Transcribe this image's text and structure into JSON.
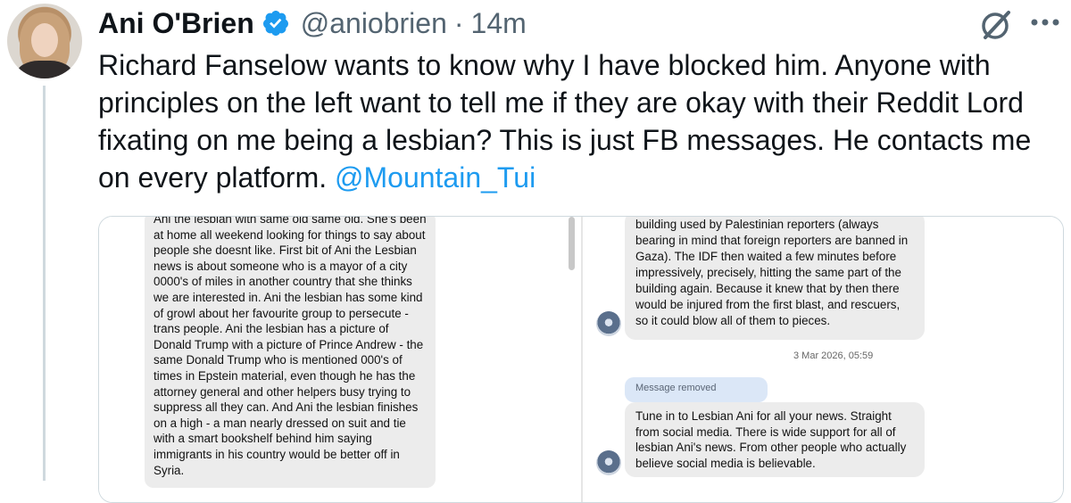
{
  "tweet": {
    "author_name": "Ani O'Brien",
    "handle": "@aniobrien",
    "separator": "·",
    "time": "14m",
    "text": "Richard Fanselow wants to know why I have blocked him. Anyone with principles on the left want to tell me if they are okay with their Reddit Lord fixating on me being a lesbian? This is just FB messages. He contacts me on every platform.",
    "mention": "@Mountain_Tui"
  },
  "icons": {
    "verified": "verified-badge-icon",
    "grok": "grok-icon",
    "more": "more-options-icon"
  },
  "colors": {
    "accent": "#1d9bf0",
    "text": "#0f1419",
    "muted": "#536471"
  },
  "media": {
    "left_message": "Ani the lesbian with same old same old. She's been at home all weekend looking for things to say about people she doesnt like. First bit of Ani the Lesbian news is about someone who is a mayor of a city 0000's of miles in another country that she thinks we are interested in. Ani the lesbian has some kind of growl about her favourite group to persecute - trans people. Ani the lesbian has a picture of Donald Trump with a picture of Prince Andrew  - the same Donald Trump who is mentioned 000's of times in Epstein material, even though he has the attorney general and other helpers busy trying to suppress all they can. And Ani the lesbian finishes on a high - a man nearly dressed on suit and tie with a smart bookshelf behind him saying immigrants in his country would be better off in Syria.",
    "right_message_1": "building used by Palestinian reporters (always bearing in mind that foreign reporters are banned in Gaza). The IDF then waited a few minutes before impressively, precisely, hitting the same part of the building again. Because it knew that by then there would be injured from the first blast, and rescuers, so it could blow all of them to pieces.",
    "timestamp": "3 Mar 2026, 05:59",
    "removed_label": "Message removed",
    "right_message_2": "Tune in to Lesbian Ani for all your news. Straight from social media. There is wide support for all of lesbian Ani's news. From other people who actually believe social media is believable."
  }
}
